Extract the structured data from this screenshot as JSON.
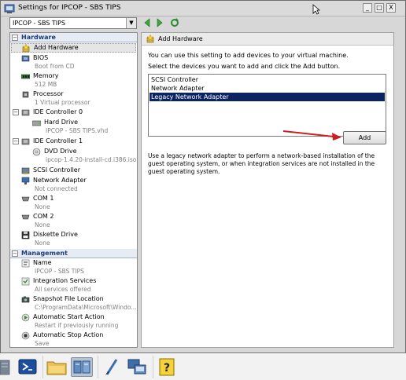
{
  "window": {
    "title": "Settings for IPCOP - SBS TIPS",
    "controls": [
      "_",
      "□",
      "X"
    ]
  },
  "toolbar": {
    "vm_selected": "IPCOP - SBS TIPS"
  },
  "sidebar": {
    "hardware_label": "Hardware",
    "management_label": "Management",
    "hardware_items": [
      {
        "label": "Add Hardware",
        "sub": ""
      },
      {
        "label": "BIOS",
        "sub": "Boot from CD"
      },
      {
        "label": "Memory",
        "sub": "512 MB"
      },
      {
        "label": "Processor",
        "sub": "1 Virtual processor"
      },
      {
        "label": "IDE Controller 0",
        "sub": ""
      },
      {
        "label": "Hard Drive",
        "sub": "IPCOP - SBS TIPS.vhd"
      },
      {
        "label": "IDE Controller 1",
        "sub": ""
      },
      {
        "label": "DVD Drive",
        "sub": "ipcop-1.4.20-install-cd.i386.iso"
      },
      {
        "label": "SCSI Controller",
        "sub": ""
      },
      {
        "label": "Network Adapter",
        "sub": "Not connected"
      },
      {
        "label": "COM 1",
        "sub": "None"
      },
      {
        "label": "COM 2",
        "sub": "None"
      },
      {
        "label": "Diskette Drive",
        "sub": "None"
      }
    ],
    "management_items": [
      {
        "label": "Name",
        "sub": "IPCOP - SBS TIPS"
      },
      {
        "label": "Integration Services",
        "sub": "All services offered"
      },
      {
        "label": "Snapshot File Location",
        "sub": "C:\\ProgramData\\Microsoft\\Windo..."
      },
      {
        "label": "Automatic Start Action",
        "sub": "Restart if previously running"
      },
      {
        "label": "Automatic Stop Action",
        "sub": "Save"
      }
    ]
  },
  "content": {
    "header": "Add Hardware",
    "intro": "You can use this setting to add devices to your virtual machine.",
    "instruction": "Select the devices you want to add and click the Add button.",
    "devices": [
      "SCSI Controller",
      "Network Adapter",
      "Legacy Network Adapter"
    ],
    "selected_device": "Legacy Network Adapter",
    "add_label": "Add",
    "description": "Use a legacy network adapter to perform a network-based installation of the guest operating system, or when integration services are not installed in the guest operating system."
  },
  "taskbar": {
    "icons": [
      "powershell-icon",
      "file-explorer-icon",
      "hyper-v-icon",
      "paint-icon",
      "network-icon",
      "help-icon"
    ],
    "active": "hyper-v-icon"
  },
  "colors": {
    "selection": "#0b2361",
    "section_header": "#1c3e7a",
    "arrow": "#cc1f1f"
  }
}
